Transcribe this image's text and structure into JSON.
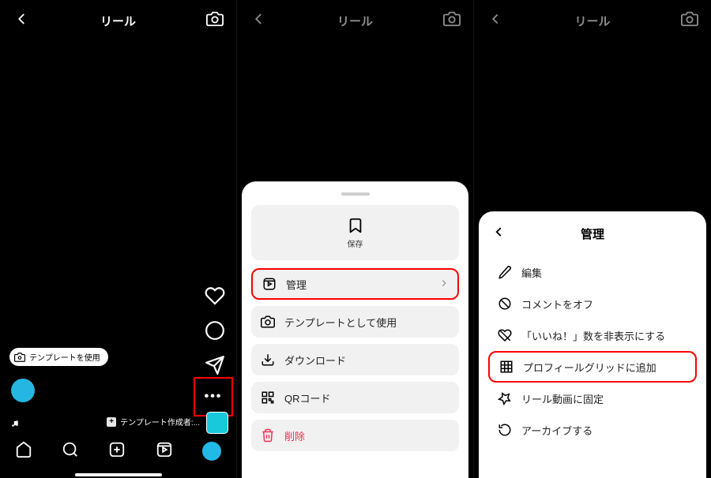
{
  "header": {
    "title": "リール"
  },
  "panel1": {
    "chip_label": "テンプレートを使用",
    "template_credit": "テンプレート作成者:..."
  },
  "sheet1": {
    "save_label": "保存",
    "rows": {
      "manage": "管理",
      "use_template": "テンプレートとして使用",
      "download": "ダウンロード",
      "qr": "QRコード",
      "delete": "削除"
    }
  },
  "sheet2": {
    "title": "管理",
    "rows": {
      "edit": "編集",
      "comments_off": "コメントをオフ",
      "hide_likes": "「いいね！」数を非表示にする",
      "add_to_grid": "プロフィールグリッドに追加",
      "pin": "リール動画に固定",
      "archive": "アーカイブする"
    }
  }
}
